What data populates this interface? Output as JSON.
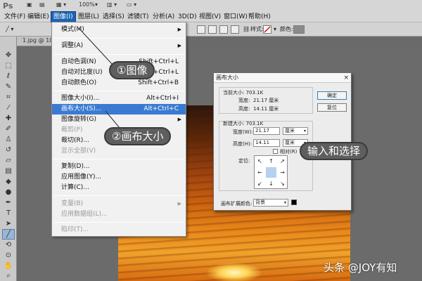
{
  "app": {
    "logo": "Ps",
    "zoom": "100%"
  },
  "menubar": {
    "items": [
      "文件(F)",
      "编辑(E)",
      "图像(I)",
      "图层(L)",
      "选择(S)",
      "滤镜(T)",
      "分析(A)",
      "3D(D)",
      "视图(V)",
      "窗口(W)",
      "帮助(H)"
    ]
  },
  "optionsbar": {
    "style_label": "样式:",
    "color_label": "颜色:"
  },
  "document": {
    "tab_label": "1.jpg @ 100"
  },
  "image_menu": {
    "items": [
      {
        "label": "模式(M)",
        "submenu": true
      },
      {
        "label": "调整(A)",
        "submenu": true
      },
      {
        "label": "自动色调(N)",
        "shortcut": "Shift+Ctrl+L"
      },
      {
        "label": "自动对比度(U)",
        "shortcut": "Alt+Shift+Ctrl+L"
      },
      {
        "label": "自动颜色(O)",
        "shortcut": "Shift+Ctrl+B"
      },
      {
        "label": "图像大小(I)...",
        "shortcut": "Alt+Ctrl+I"
      },
      {
        "label": "画布大小(S)...",
        "shortcut": "Alt+Ctrl+C",
        "highlighted": true
      },
      {
        "label": "图像旋转(G)",
        "submenu": true
      },
      {
        "label": "裁剪(P)",
        "disabled": true
      },
      {
        "label": "裁切(R)..."
      },
      {
        "label": "显示全部(V)",
        "disabled": true
      },
      {
        "label": "复制(D)..."
      },
      {
        "label": "应用图像(Y)..."
      },
      {
        "label": "计算(C)..."
      },
      {
        "label": "变量(B)",
        "disabled": true,
        "submenu": true
      },
      {
        "label": "应用数据组(L)...",
        "disabled": true
      },
      {
        "label": "陷印(T)...",
        "disabled": true
      }
    ]
  },
  "callouts": {
    "step1": "①图像",
    "step2": "②画布大小",
    "step3": "输入和选择"
  },
  "dialog": {
    "title": "画布大小",
    "close": "×",
    "current_size": "当前大小: 703.1K",
    "current_width_label": "宽度:",
    "current_width": "21.17 厘米",
    "current_height_label": "高度:",
    "current_height": "14.11 厘米",
    "new_size": "新建大小: 703.1K",
    "width_label": "宽度(W):",
    "width_value": "21.17",
    "width_unit": "厘米",
    "height_label": "高度(H):",
    "height_value": "14.11",
    "height_unit": "厘米",
    "relative_label": "相对(R)",
    "anchor_label": "定位:",
    "extension_color_label": "画布扩展颜色:",
    "extension_color_value": "背景",
    "ok_button": "确定",
    "reset_button": "复位"
  },
  "watermark": "头条 @JOY有知"
}
